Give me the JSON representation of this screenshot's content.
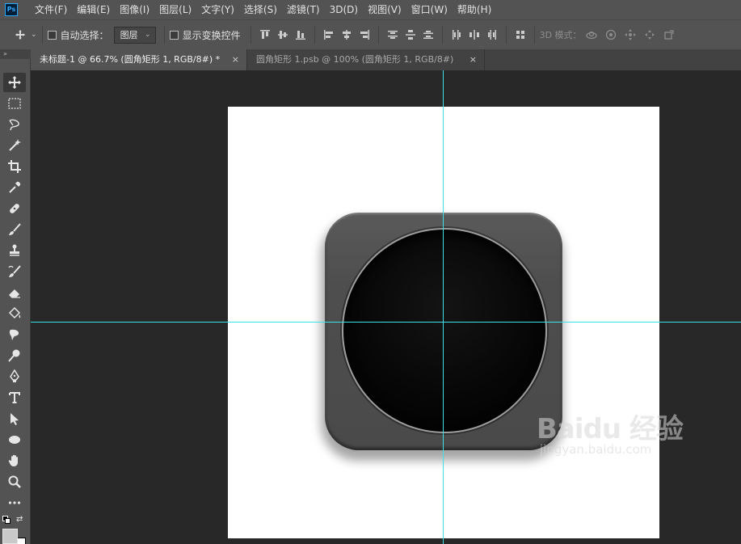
{
  "app": {
    "logo_text": "Ps",
    "accent_color": "#31a8ff",
    "guide_color": "#3fe0e8"
  },
  "menu": {
    "items": [
      {
        "label": "文件(F)"
      },
      {
        "label": "编辑(E)"
      },
      {
        "label": "图像(I)"
      },
      {
        "label": "图层(L)"
      },
      {
        "label": "文字(Y)"
      },
      {
        "label": "选择(S)"
      },
      {
        "label": "滤镜(T)"
      },
      {
        "label": "3D(D)"
      },
      {
        "label": "视图(V)"
      },
      {
        "label": "窗口(W)"
      },
      {
        "label": "帮助(H)"
      }
    ]
  },
  "options": {
    "auto_select_label": "自动选择：",
    "auto_select_checked": false,
    "auto_select_target": "图层",
    "show_transform_label": "显示变换控件",
    "show_transform_checked": false,
    "mode_3d_label": "3D 模式："
  },
  "tabs": [
    {
      "title": "未标题-1 @ 66.7% (圆角矩形 1, RGB/8#) *",
      "close": "×",
      "active": true
    },
    {
      "title": "圆角矩形 1.psb @ 100% (圆角矩形 1, RGB/8#)",
      "close": "×",
      "active": false
    }
  ],
  "tools": [
    {
      "icon": "move-icon",
      "selected": true
    },
    {
      "icon": "rectangular-marquee-icon"
    },
    {
      "icon": "lasso-icon"
    },
    {
      "icon": "magic-wand-icon"
    },
    {
      "icon": "crop-icon"
    },
    {
      "icon": "eyedropper-icon"
    },
    {
      "icon": "healing-brush-icon"
    },
    {
      "icon": "brush-icon"
    },
    {
      "icon": "clone-stamp-icon"
    },
    {
      "icon": "history-brush-icon"
    },
    {
      "icon": "eraser-icon"
    },
    {
      "icon": "paint-bucket-icon"
    },
    {
      "icon": "smudge-icon"
    },
    {
      "icon": "dodge-icon"
    },
    {
      "icon": "pen-icon"
    },
    {
      "icon": "type-icon"
    },
    {
      "icon": "path-selection-icon"
    },
    {
      "icon": "ellipse-icon"
    },
    {
      "icon": "hand-icon"
    },
    {
      "icon": "zoom-icon"
    },
    {
      "icon": "more-tools-icon"
    }
  ],
  "watermark": {
    "logo": "Baidu 经验",
    "url": "jingyan.baidu.com"
  }
}
